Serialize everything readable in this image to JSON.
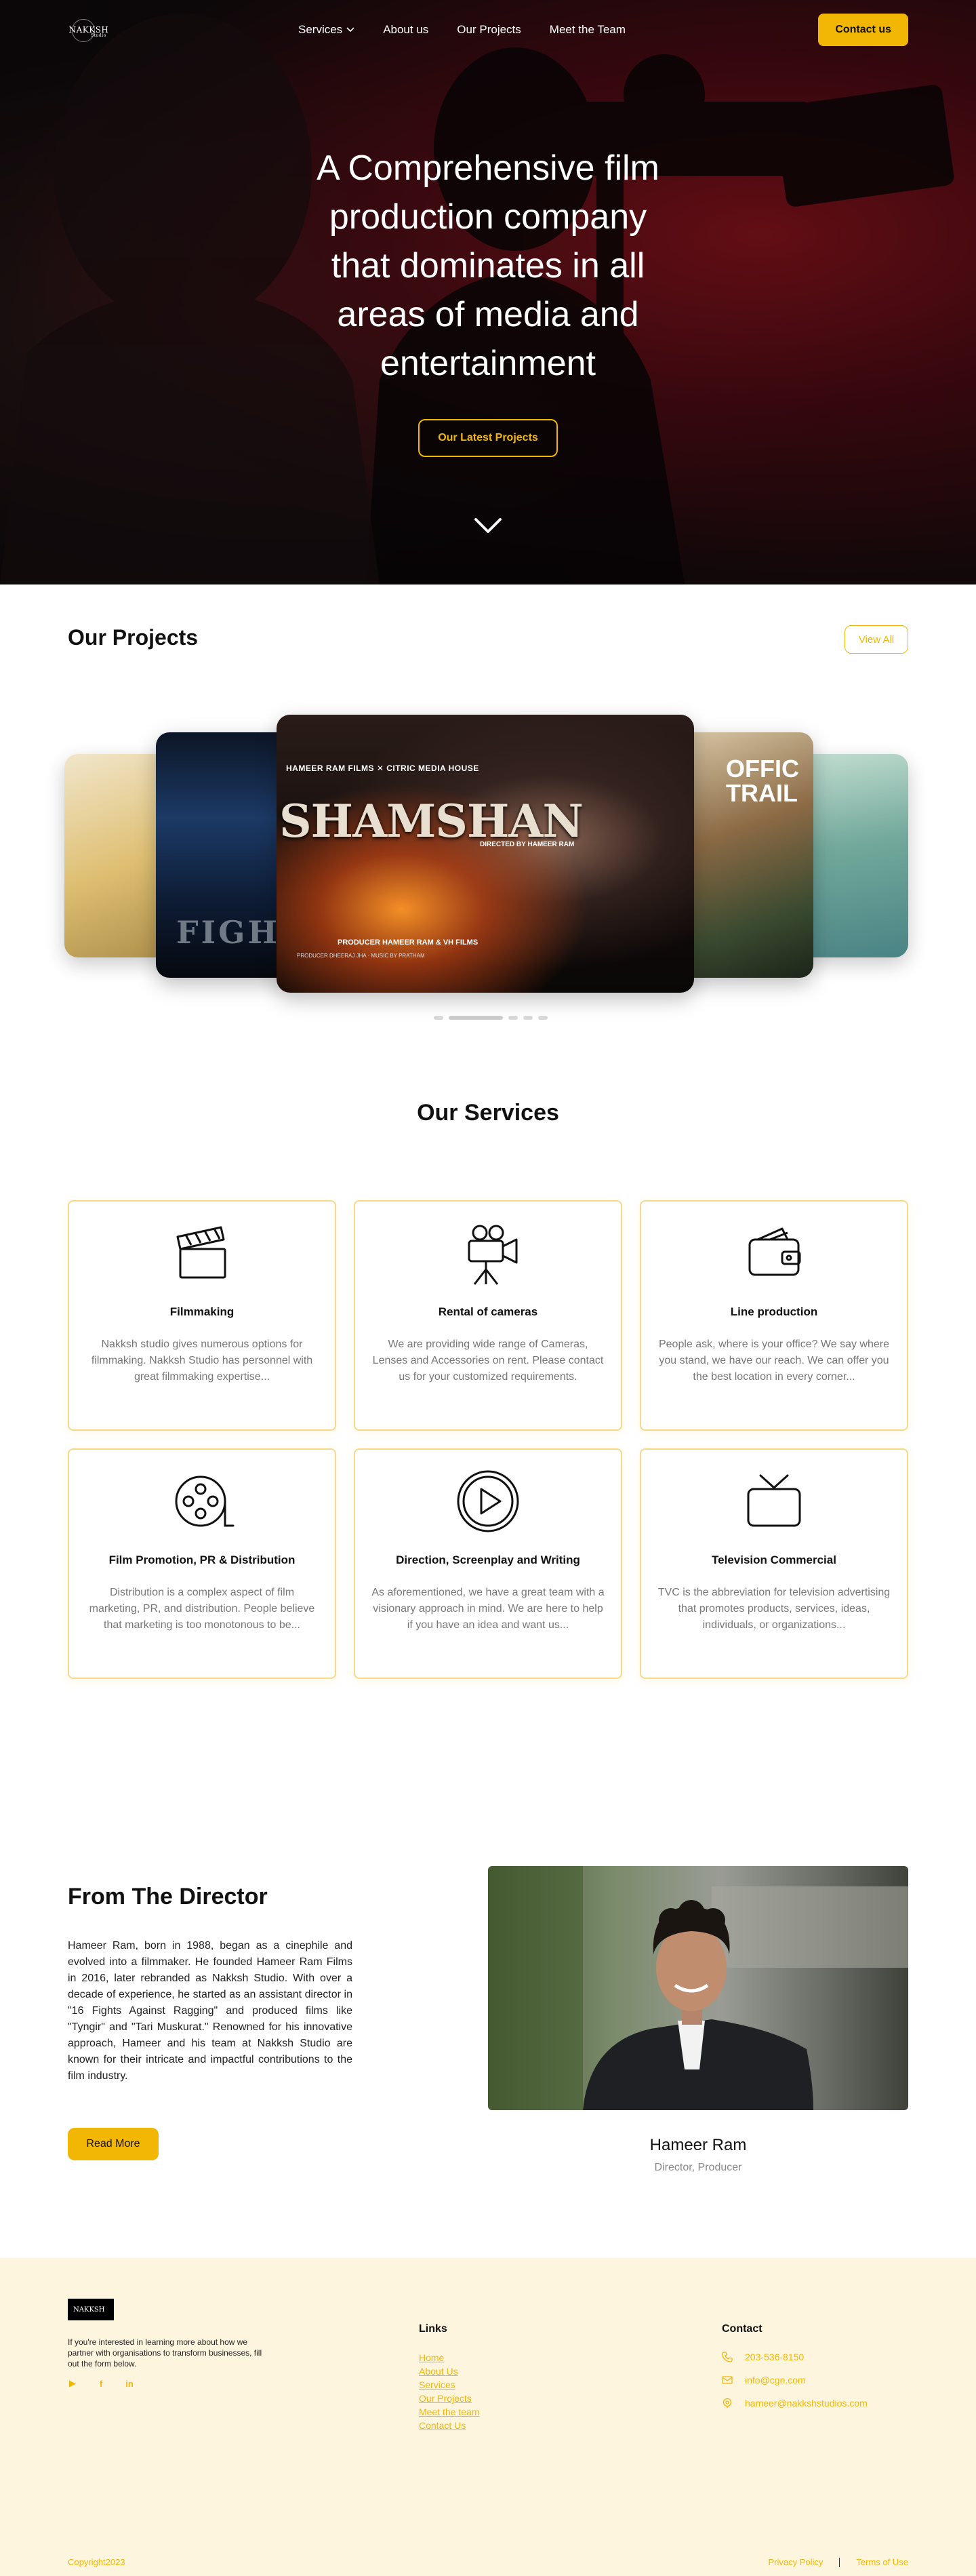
{
  "nav": {
    "logo_text": "NAKKSH",
    "logo_sub": "Studio",
    "links": [
      "Services",
      "About us",
      "Our Projects",
      "Meet the Team"
    ],
    "contact_label": "Contact us"
  },
  "hero": {
    "title_lines": [
      "A Comprehensive film",
      "production company",
      "that dominates in all",
      "areas of media and",
      "entertainment"
    ],
    "cta_label": "Our Latest Projects"
  },
  "projects": {
    "title": "Our Projects",
    "view_all_label": "View All",
    "featured_poster": {
      "top_line": "HAMEER RAM FILMS  ✕  CITRIC MEDIA HOUSE",
      "title": "SHAMSHAN",
      "director_line": "DIRECTED BY  HAMEER RAM",
      "producer_line": "PRODUCER  HAMEER RAM  &  VH FILMS",
      "credits": "PRODUCER  DHEERAJ JHA  ·  MUSIC BY  PRATHAM"
    },
    "poster_fight": "FIGHT",
    "poster_official": "OFFIC TRAIL"
  },
  "services": {
    "title": "Our Services",
    "items": [
      {
        "icon": "clapperboard-icon",
        "title": "Filmmaking",
        "desc": "Nakksh studio gives numerous options for filmmaking. Nakksh Studio has personnel with great filmmaking expertise..."
      },
      {
        "icon": "video-camera-icon",
        "title": "Rental of cameras",
        "desc": "We are providing wide range of Cameras, Lenses and Accessories on rent. Please contact us for your customized requirements."
      },
      {
        "icon": "wallet-icon",
        "title": "Line production",
        "desc": "People ask, where is your office? We say where you stand, we have our reach. We can offer you the best location in every corner..."
      },
      {
        "icon": "film-reel-icon",
        "title": "Film Promotion, PR & Distribution",
        "desc": "Distribution is a complex aspect of film marketing, PR, and distribution. People believe that marketing is too monotonous to be..."
      },
      {
        "icon": "play-circle-icon",
        "title": "Direction, Screenplay and Writing",
        "desc": "As aforementioned, we have a great team with a visionary approach in mind. We are here to help if you have an idea and want us..."
      },
      {
        "icon": "television-icon",
        "title": "Television Commercial",
        "desc": "TVC is the abbreviation for television advertising that promotes products, services, ideas, individuals, or organizations..."
      }
    ]
  },
  "director": {
    "title": "From The Director",
    "bio": "Hameer Ram, born in 1988, began as a cinephile and evolved into a filmmaker. He founded Hameer Ram Films in 2016, later rebranded as Nakksh Studio. With over a decade of experience, he started as an assistant director in \"16 Fights Against Ragging\" and produced films like \"Tyngir\" and \"Tari Muskurat.\" Renowned for his innovative approach, Hameer and his team at Nakksh Studio are known for their intricate and impactful contributions to the film industry.",
    "read_more_label": "Read More",
    "name": "Hameer Ram",
    "role": "Director, Producer"
  },
  "footer": {
    "logo_text": "NAKKSH",
    "description": "If you're interested in learning more about how we partner with organisations to transform businesses, fill out the form below.",
    "social": [
      "youtube-icon",
      "facebook-icon",
      "linkedin-icon"
    ],
    "links_title": "Links",
    "links": [
      "Home",
      "About Us",
      "Services",
      "Our Projects",
      "Meet the team",
      "Contact Us"
    ],
    "contact_title": "Contact",
    "phone": "203-536-8150",
    "email": "info@cgn.com",
    "email2": "hameer@nakkshstudios.com",
    "copyright": "Copyright2023",
    "privacy": "Privacy Policy",
    "terms": "Terms of Use"
  },
  "colors": {
    "accent": "#f2b705",
    "footer_bg": "#fdf5de"
  }
}
